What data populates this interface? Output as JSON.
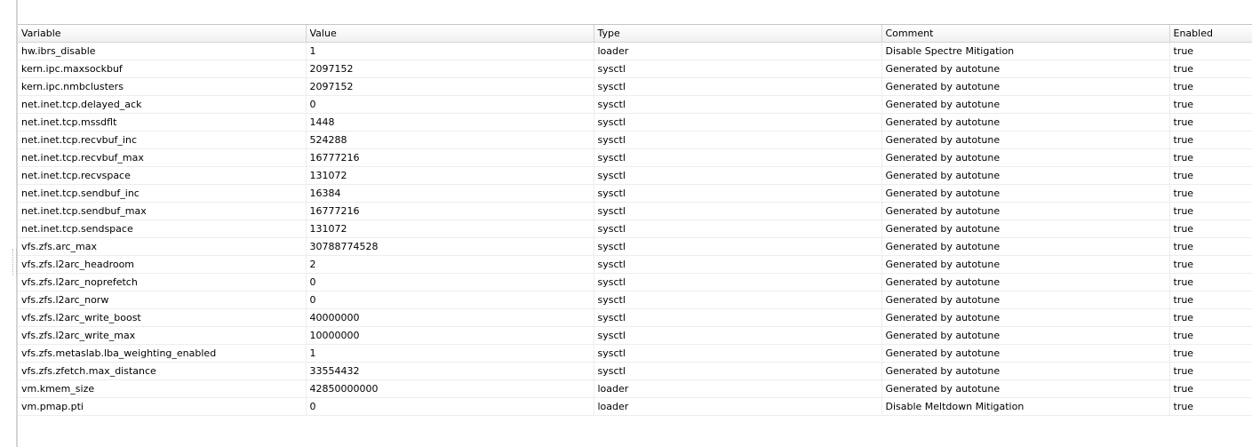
{
  "columns": [
    {
      "key": "variable",
      "label": "Variable"
    },
    {
      "key": "value",
      "label": "Value"
    },
    {
      "key": "type",
      "label": "Type"
    },
    {
      "key": "comment",
      "label": "Comment"
    },
    {
      "key": "enabled",
      "label": "Enabled"
    }
  ],
  "rows": [
    {
      "variable": "hw.ibrs_disable",
      "value": "1",
      "type": "loader",
      "comment": "Disable Spectre Mitigation",
      "enabled": "true"
    },
    {
      "variable": "kern.ipc.maxsockbuf",
      "value": "2097152",
      "type": "sysctl",
      "comment": "Generated by autotune",
      "enabled": "true"
    },
    {
      "variable": "kern.ipc.nmbclusters",
      "value": "2097152",
      "type": "sysctl",
      "comment": "Generated by autotune",
      "enabled": "true"
    },
    {
      "variable": "net.inet.tcp.delayed_ack",
      "value": "0",
      "type": "sysctl",
      "comment": "Generated by autotune",
      "enabled": "true"
    },
    {
      "variable": "net.inet.tcp.mssdflt",
      "value": "1448",
      "type": "sysctl",
      "comment": "Generated by autotune",
      "enabled": "true"
    },
    {
      "variable": "net.inet.tcp.recvbuf_inc",
      "value": "524288",
      "type": "sysctl",
      "comment": "Generated by autotune",
      "enabled": "true"
    },
    {
      "variable": "net.inet.tcp.recvbuf_max",
      "value": "16777216",
      "type": "sysctl",
      "comment": "Generated by autotune",
      "enabled": "true"
    },
    {
      "variable": "net.inet.tcp.recvspace",
      "value": "131072",
      "type": "sysctl",
      "comment": "Generated by autotune",
      "enabled": "true"
    },
    {
      "variable": "net.inet.tcp.sendbuf_inc",
      "value": "16384",
      "type": "sysctl",
      "comment": "Generated by autotune",
      "enabled": "true"
    },
    {
      "variable": "net.inet.tcp.sendbuf_max",
      "value": "16777216",
      "type": "sysctl",
      "comment": "Generated by autotune",
      "enabled": "true"
    },
    {
      "variable": "net.inet.tcp.sendspace",
      "value": "131072",
      "type": "sysctl",
      "comment": "Generated by autotune",
      "enabled": "true"
    },
    {
      "variable": "vfs.zfs.arc_max",
      "value": "30788774528",
      "type": "sysctl",
      "comment": "Generated by autotune",
      "enabled": "true"
    },
    {
      "variable": "vfs.zfs.l2arc_headroom",
      "value": "2",
      "type": "sysctl",
      "comment": "Generated by autotune",
      "enabled": "true"
    },
    {
      "variable": "vfs.zfs.l2arc_noprefetch",
      "value": "0",
      "type": "sysctl",
      "comment": "Generated by autotune",
      "enabled": "true"
    },
    {
      "variable": "vfs.zfs.l2arc_norw",
      "value": "0",
      "type": "sysctl",
      "comment": "Generated by autotune",
      "enabled": "true"
    },
    {
      "variable": "vfs.zfs.l2arc_write_boost",
      "value": "40000000",
      "type": "sysctl",
      "comment": "Generated by autotune",
      "enabled": "true"
    },
    {
      "variable": "vfs.zfs.l2arc_write_max",
      "value": "10000000",
      "type": "sysctl",
      "comment": "Generated by autotune",
      "enabled": "true"
    },
    {
      "variable": "vfs.zfs.metaslab.lba_weighting_enabled",
      "value": "1",
      "type": "sysctl",
      "comment": "Generated by autotune",
      "enabled": "true"
    },
    {
      "variable": "vfs.zfs.zfetch.max_distance",
      "value": "33554432",
      "type": "sysctl",
      "comment": "Generated by autotune",
      "enabled": "true"
    },
    {
      "variable": "vm.kmem_size",
      "value": "42850000000",
      "type": "loader",
      "comment": "Generated by autotune",
      "enabled": "true"
    },
    {
      "variable": "vm.pmap.pti",
      "value": "0",
      "type": "loader",
      "comment": "Disable Meltdown Mitigation",
      "enabled": "true"
    }
  ]
}
